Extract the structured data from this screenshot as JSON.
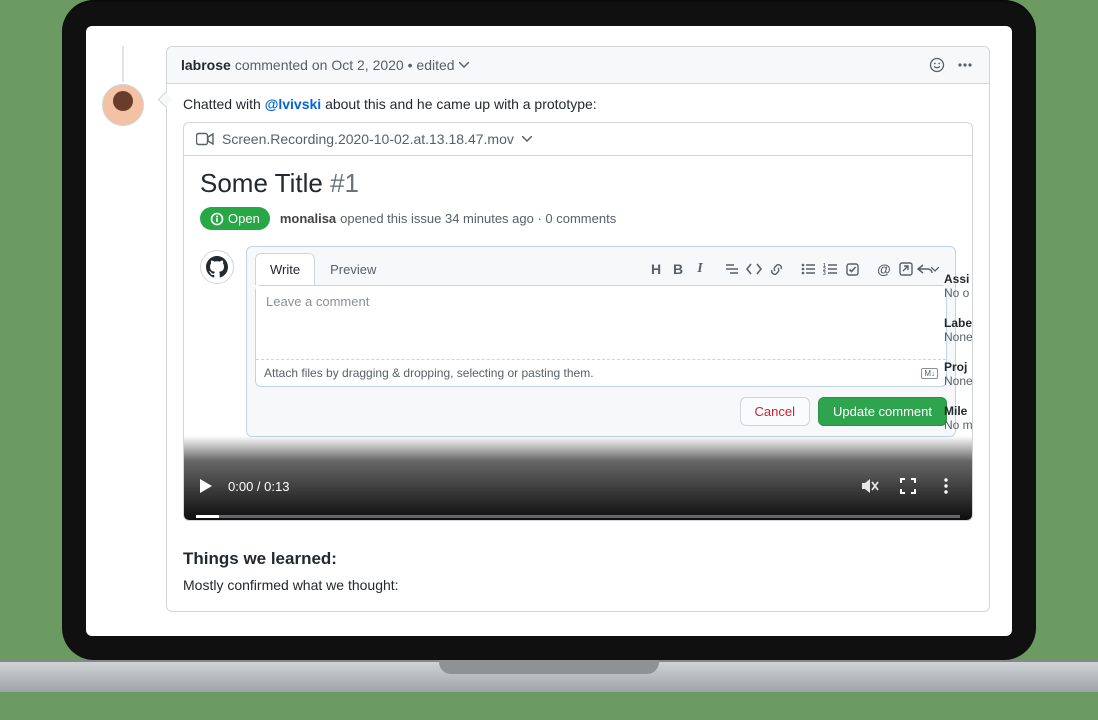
{
  "comment": {
    "author": "labrose",
    "action": "commented",
    "date_prefix": "on",
    "date": "Oct 2, 2020",
    "edited_label": "edited",
    "body_prefix": "Chatted with ",
    "body_mention": "@lvivski",
    "body_suffix": " about this and he came up with a prototype:"
  },
  "video": {
    "filename": "Screen.Recording.2020-10-02.at.13.18.47.mov",
    "current_time": "0:00",
    "duration": "0:13"
  },
  "issue": {
    "title": "Some Title",
    "number": "#1",
    "state_label": "Open",
    "author": "monalisa",
    "meta_text": "opened this issue 34 minutes ago · 0 comments"
  },
  "editor": {
    "tab_write": "Write",
    "tab_preview": "Preview",
    "placeholder": "Leave a comment",
    "attach_hint": "Attach files by dragging & dropping, selecting or pasting them.",
    "md_badge": "M↓",
    "cancel": "Cancel",
    "submit": "Update comment"
  },
  "sidebar": {
    "assignees_label": "Assi",
    "assignees_value": "No o",
    "labels_label": "Labe",
    "labels_value": "None",
    "projects_label": "Proj",
    "projects_value": "None",
    "milestone_label": "Mile",
    "milestone_value": "No m"
  },
  "section": {
    "heading": "Things we learned:",
    "line1": "Mostly confirmed what we thought:"
  }
}
